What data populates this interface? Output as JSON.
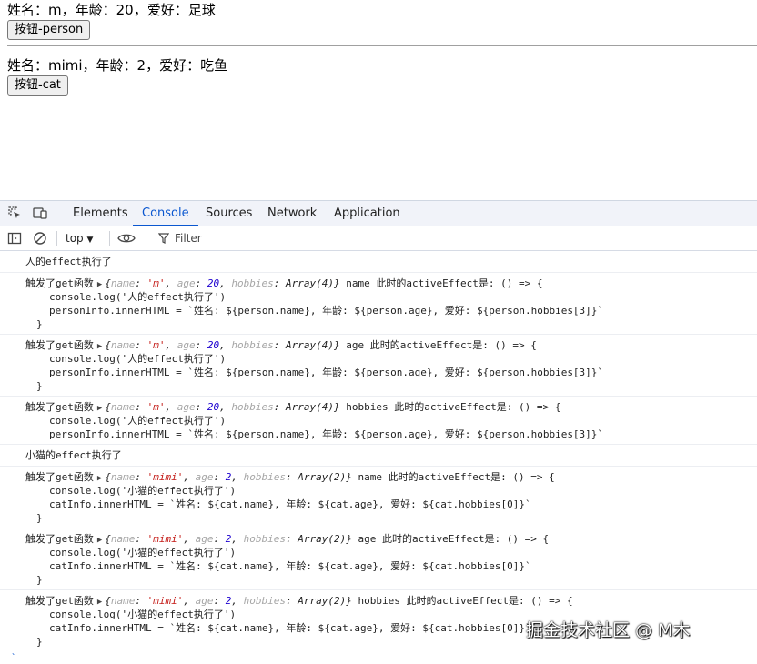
{
  "page": {
    "person_text": "姓名：m，年龄：20，爱好：足球",
    "person_button": "按钮-person",
    "cat_text": "姓名：mimi，年龄：2，爱好：吃鱼",
    "cat_button": "按钮-cat"
  },
  "devtools": {
    "tabs": [
      "Elements",
      "Console",
      "Sources",
      "Network",
      "Application"
    ],
    "active_tab": "Console",
    "context": "top",
    "filter_placeholder": "Filter",
    "accent_color": "#0b57d0"
  },
  "console": {
    "person_effect_log": "人的effect执行了",
    "cat_effect_log": "小猫的effect执行了",
    "get_prefix": "触发了get函数",
    "active_suffix": "此时的activeEffect是: () => {",
    "person_obj": {
      "open": "{",
      "name_key": "name",
      "name_val": "'m'",
      "age_key": "age",
      "age_val": "20",
      "hobbies_key": "hobbies",
      "hobbies_val": "Array(4)",
      "close": "}"
    },
    "cat_obj": {
      "open": "{",
      "name_key": "name",
      "name_val": "'mimi'",
      "age_key": "age",
      "age_val": "2",
      "hobbies_key": "hobbies",
      "hobbies_val": "Array(2)",
      "close": "}"
    },
    "person_body_1": "console.log('人的effect执行了')",
    "person_body_2": "personInfo.innerHTML = `姓名: ${person.name}, 年龄: ${person.age}, 爱好: ${person.hobbies[3]}`",
    "cat_body_1": "console.log('小猫的effect执行了')",
    "cat_body_2": "catInfo.innerHTML = `姓名: ${cat.name}, 年龄: ${cat.age}, 爱好: ${cat.hobbies[0]}`",
    "fn_close": "}",
    "person_props": [
      "name",
      "age",
      "hobbies"
    ],
    "cat_props": [
      "name",
      "age",
      "hobbies"
    ]
  },
  "watermark": "掘金技术社区 @ M木",
  "prompt_char": "`"
}
